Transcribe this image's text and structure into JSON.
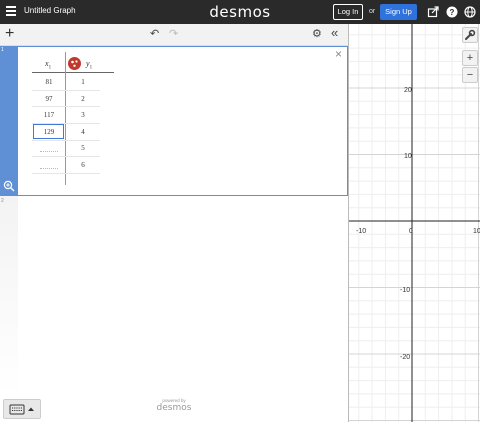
{
  "header": {
    "title": "Untitled Graph",
    "logo": "desmos",
    "login_label": "Log In",
    "or_label": "or",
    "signup_label": "Sign Up",
    "accent": "#2f72dc"
  },
  "toolbar": {
    "add_label": "+",
    "undo_icon": "undo-icon",
    "redo_icon": "redo-icon",
    "settings_icon": "gear-icon",
    "collapse_label": "«"
  },
  "expressions": {
    "item1_index": "1",
    "item2_index": "2",
    "close_label": "×",
    "table": {
      "col_x": "x",
      "col_x_sub": "1",
      "col_y": "y",
      "col_y_sub": "1",
      "x_values": [
        "81",
        "97",
        "117",
        "129"
      ],
      "y_values": [
        "1",
        "2",
        "3",
        "4",
        "5",
        "6"
      ]
    }
  },
  "graph": {
    "x_ticks": [
      "-10",
      "0",
      "10"
    ],
    "y_ticks": [
      "20",
      "10",
      "-10",
      "-20"
    ],
    "settings_icon": "wrench-icon",
    "zoom_in_label": "+",
    "zoom_out_label": "−"
  },
  "footer": {
    "powered_by": "powered by",
    "brand": "desmos"
  }
}
